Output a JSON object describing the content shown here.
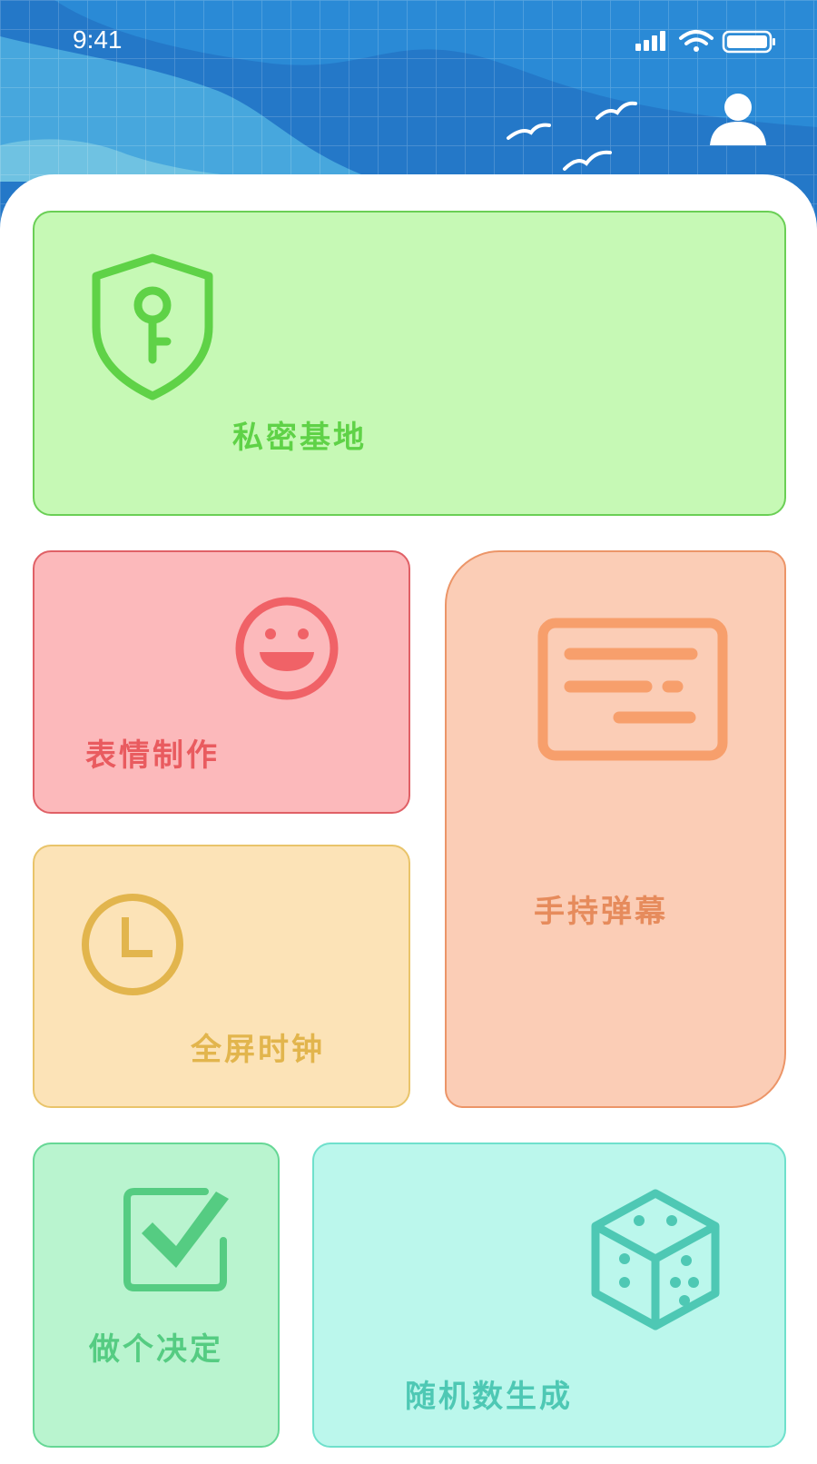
{
  "status_bar": {
    "time": "9:41",
    "icons": [
      "signal-icon",
      "wifi-icon",
      "battery-icon"
    ]
  },
  "header": {
    "profile_icon": "user-icon",
    "decoration": "blue grid background with waves and birds"
  },
  "cards": {
    "private_base": {
      "label": "私密基地",
      "icon": "shield-key-icon",
      "color": "#5fd247"
    },
    "emoji_maker": {
      "label": "表情制作",
      "icon": "smiley-icon",
      "color": "#e95b5f"
    },
    "handheld_danmaku": {
      "label": "手持弹幕",
      "icon": "danmaku-screen-icon",
      "color": "#e68b5c"
    },
    "fullscreen_clock": {
      "label": "全屏时钟",
      "icon": "clock-icon",
      "color": "#e2b54d"
    },
    "make_decision": {
      "label": "做个决定",
      "icon": "checkbox-icon",
      "color": "#55cc82"
    },
    "random_number": {
      "label": "随机数生成",
      "icon": "dice-icon",
      "color": "#4ec8b4"
    }
  }
}
